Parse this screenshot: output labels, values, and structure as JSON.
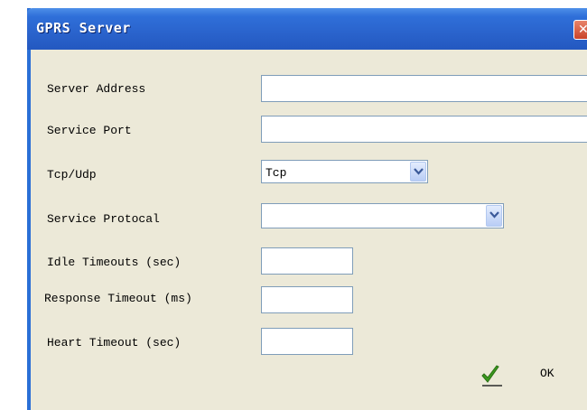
{
  "window": {
    "title": "GPRS Server",
    "close_glyph": "✕"
  },
  "form": {
    "server_address": {
      "label": "Server Address",
      "value": ""
    },
    "service_port": {
      "label": "Service Port",
      "value": ""
    },
    "tcp_udp": {
      "label": "Tcp/Udp",
      "selected": "Tcp"
    },
    "service_protocol": {
      "label": "Service Protocal",
      "selected": ""
    },
    "idle_timeouts": {
      "label": "Idle Timeouts (sec)",
      "value": ""
    },
    "response_timeout": {
      "label": "Response Timeout (ms)",
      "value": ""
    },
    "heart_timeout": {
      "label": "Heart Timeout (sec)",
      "value": ""
    }
  },
  "actions": {
    "ok_label": "OK",
    "ok_icon": "checkmark-icon"
  },
  "colors": {
    "titlebar": "#2a63cc",
    "dialog_bg": "#ece9d8",
    "field_border": "#7f9db9",
    "check_green": "#3a9a1e"
  }
}
